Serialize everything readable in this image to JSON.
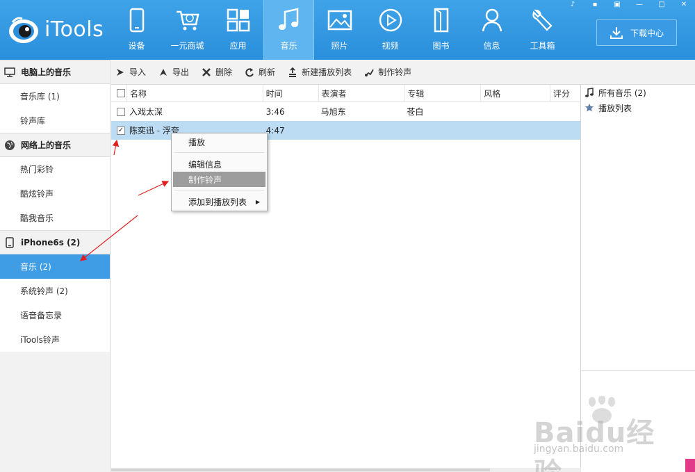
{
  "app": {
    "name": "iTools"
  },
  "nav": [
    {
      "label": "设备",
      "icon": "device-icon"
    },
    {
      "label": "一元商城",
      "icon": "cart-icon"
    },
    {
      "label": "应用",
      "icon": "apps-icon"
    },
    {
      "label": "音乐",
      "icon": "music-icon",
      "active": true
    },
    {
      "label": "照片",
      "icon": "photo-icon"
    },
    {
      "label": "视频",
      "icon": "video-icon"
    },
    {
      "label": "图书",
      "icon": "book-icon"
    },
    {
      "label": "信息",
      "icon": "contact-icon"
    },
    {
      "label": "工具箱",
      "icon": "wrench-icon"
    }
  ],
  "download_center": "下载中心",
  "sidebar": {
    "sections": [
      {
        "title": "电脑上的音乐",
        "icon": "monitor-icon",
        "items": [
          "音乐库 (1)",
          "铃声库"
        ]
      },
      {
        "title": "网络上的音乐",
        "icon": "globe-icon",
        "items": [
          "热门彩铃",
          "酷炫铃声",
          "酷我音乐"
        ]
      },
      {
        "title": "iPhone6s (2)",
        "icon": "phone-icon",
        "items": [
          "音乐 (2)",
          "系统铃声 (2)",
          "语音备忘录",
          "iTools铃声"
        ],
        "selected": "音乐 (2)"
      }
    ]
  },
  "toolbar": {
    "import": "导入",
    "export": "导出",
    "delete": "删除",
    "refresh": "刷新",
    "new_playlist": "新建播放列表",
    "make_ringtone": "制作铃声"
  },
  "table": {
    "headers": {
      "name": "名称",
      "time": "时间",
      "artist": "表演者",
      "album": "专辑",
      "genre": "风格",
      "rating": "评分"
    },
    "rows": [
      {
        "name": "入戏太深",
        "time": "3:46",
        "artist": "马旭东",
        "album": "苍白",
        "genre": "",
        "rating": "",
        "checked": false
      },
      {
        "name": "陈奕迅 - 浮夸",
        "time": "4:47",
        "artist": "",
        "album": "",
        "genre": "",
        "rating": "",
        "checked": true
      }
    ]
  },
  "right_panel": {
    "all_music": "所有音乐 (2)",
    "playlists": "播放列表"
  },
  "context_menu": {
    "play": "播放",
    "edit_info": "编辑信息",
    "make_ringtone": "制作铃声",
    "add_to_playlist": "添加到播放列表"
  },
  "watermark": {
    "logo": "Baidu经验",
    "url": "jingyan.baidu.com"
  },
  "colors": {
    "header": "#2a8fdc",
    "selected": "#3f9de6",
    "row_selected": "#bcdcf4",
    "annotation": "#e02020"
  }
}
